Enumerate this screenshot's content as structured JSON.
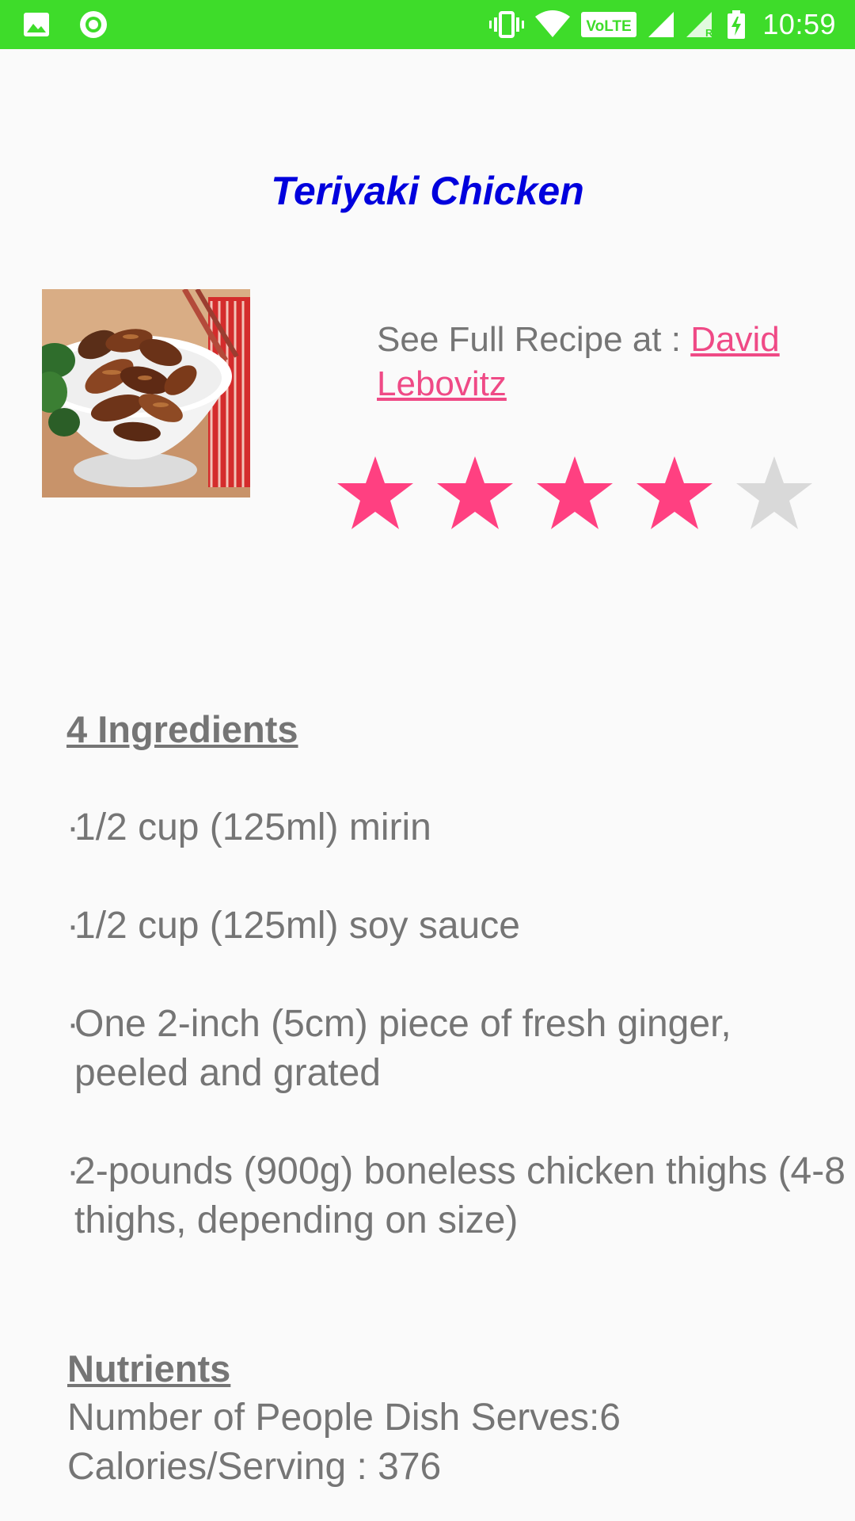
{
  "status_bar": {
    "time": "10:59",
    "left_icons": [
      "gallery-icon",
      "circle-notification-icon"
    ],
    "right_icons": [
      "vibrate-icon",
      "wifi-icon",
      "volte-icon",
      "signal-icon",
      "signal-roaming-icon",
      "battery-charging-icon"
    ],
    "volte_label": "VoLTE",
    "roaming_label": "R",
    "background_color": "#3edc2a"
  },
  "recipe": {
    "title": "Teriyaki Chicken",
    "title_color": "#0000dd",
    "image_icon": "teriyaki-chicken-photo",
    "source_prefix": "See Full Recipe at : ",
    "source_link": "David Lebovitz",
    "link_color": "#ef4a86",
    "rating": {
      "value": 4,
      "max": 5,
      "filled_color": "#ff4081",
      "empty_color": "#d9d9d9"
    }
  },
  "ingredients": {
    "heading": "4 Ingredients",
    "bullet": "·",
    "items": [
      "1/2 cup (125ml) mirin",
      "1/2 cup (125ml) soy sauce",
      "One 2-inch (5cm) piece of fresh ginger, peeled and grated",
      "2-pounds (900g) boneless chicken thighs (4-8 thighs, depending on size)"
    ]
  },
  "nutrients": {
    "heading": "Nutrients",
    "serves_line": "Number of People Dish Serves:6",
    "calories_line": "Calories/Serving : 376"
  }
}
